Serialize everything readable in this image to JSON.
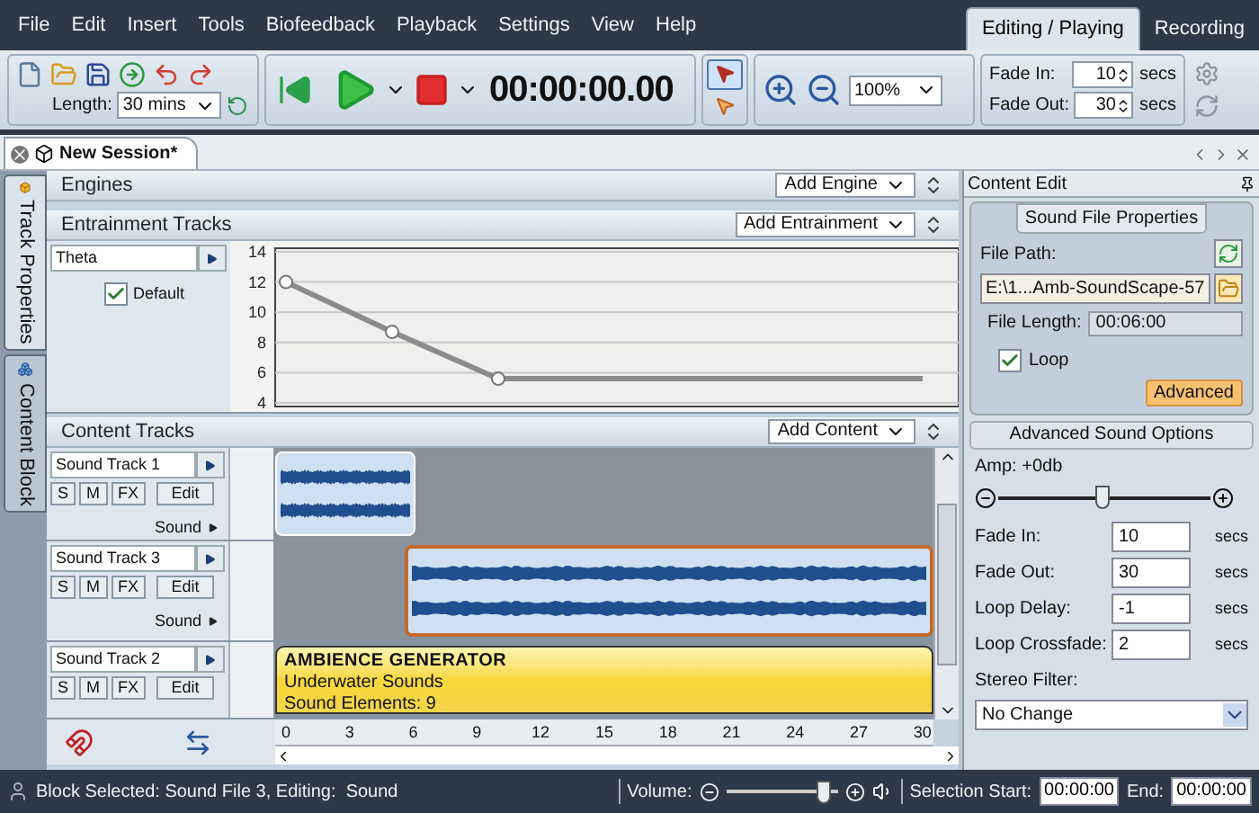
{
  "menu": [
    "File",
    "Edit",
    "Insert",
    "Tools",
    "Biofeedback",
    "Playback",
    "Settings",
    "View",
    "Help"
  ],
  "mode_tabs": [
    {
      "label": "Editing / Playing",
      "selected": true
    },
    {
      "label": "Recording",
      "selected": false
    }
  ],
  "toolbar": {
    "length_label": "Length:",
    "length_value": "30 mins",
    "time": "00:00:00.00",
    "tools": [
      {
        "selected": true
      },
      {
        "selected": false
      }
    ],
    "zoom": "100%",
    "fades": [
      {
        "label": "Fade In:",
        "value": "10",
        "unit": "secs"
      },
      {
        "label": "Fade Out:",
        "value": "30",
        "unit": "secs"
      }
    ]
  },
  "document_tabs": [
    {
      "label": "New Session*",
      "selected": true
    }
  ],
  "side_tabs": [
    {
      "label": "Track Properties",
      "selected": true
    },
    {
      "label": "Content Block",
      "selected": false
    }
  ],
  "engines": {
    "title": "Engines",
    "add_button": "Add Engine"
  },
  "entrainment": {
    "title": "Entrainment Tracks",
    "add_button": "Add Entrainment",
    "track_name": "Theta",
    "default_option": {
      "label": "Default",
      "checked": true
    },
    "envelope_axis_labels": [
      "14",
      "12",
      "10",
      "8",
      "6",
      "4"
    ]
  },
  "content": {
    "title": "Content Tracks",
    "add_button": "Add Content",
    "tracks": [
      {
        "name": "Sound Track 1",
        "buttons": [
          "S",
          "M",
          "FX",
          "Edit"
        ],
        "type_label": "Sound",
        "block": {
          "kind": "audio",
          "selected": false
        }
      },
      {
        "name": "Sound Track 3",
        "buttons": [
          "S",
          "M",
          "FX",
          "Edit"
        ],
        "type_label": "Sound",
        "block": {
          "kind": "audio",
          "selected": true
        }
      },
      {
        "name": "Sound Track 2",
        "buttons": [
          "S",
          "M",
          "FX",
          "Edit"
        ],
        "block": {
          "kind": "generator",
          "selected": false,
          "title": "AMBIENCE GENERATOR",
          "lines": [
            "Underwater Sounds",
            "Sound Elements: 9"
          ]
        }
      }
    ],
    "ruler": [
      "0",
      "3",
      "6",
      "9",
      "12",
      "15",
      "18",
      "21",
      "24",
      "27",
      "30"
    ]
  },
  "content_edit": {
    "title": "Content Edit",
    "group_title": "Sound File Properties",
    "file_path_label": "File Path:",
    "file_path": "E:\\1...Amb-SoundScape-57",
    "file_length_label": "File Length:",
    "file_length": "00:06:00",
    "loop": {
      "label": "Loop",
      "checked": true
    },
    "advanced_button": "Advanced",
    "advanced_title": "Advanced Sound Options",
    "amp": {
      "label": "Amp: +0db",
      "level": 0.5
    },
    "fields": [
      {
        "label": "Fade In:",
        "value": "10",
        "unit": "secs"
      },
      {
        "label": "Fade Out:",
        "value": "30",
        "unit": "secs"
      },
      {
        "label": "Loop Delay:",
        "value": "-1",
        "unit": "secs"
      },
      {
        "label": "Loop Crossfade:",
        "value": "2",
        "unit": "secs"
      }
    ],
    "stereo_filter": {
      "label": "Stereo Filter:",
      "value": "No Change"
    }
  },
  "status_bar": {
    "message": "Block Selected: Sound File 3, Editing:  Sound",
    "volume": {
      "label": "Volume:",
      "level": 0.88
    },
    "selection_start_label": "Selection Start:",
    "selection_start": "00:00:00",
    "end_label": "End:",
    "end": "00:00:00"
  }
}
